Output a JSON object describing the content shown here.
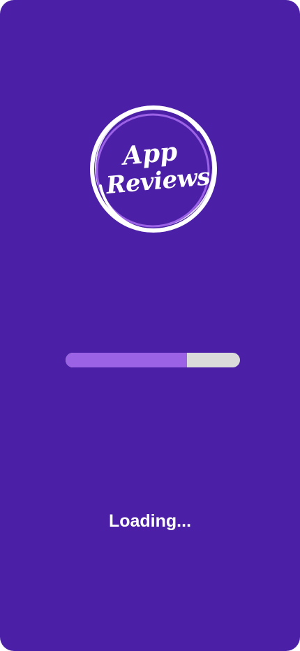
{
  "app": {
    "logo_line1": "App",
    "logo_line2": "Reviews"
  },
  "loading": {
    "label": "Loading...",
    "progress_fraction": 0.695
  },
  "colors": {
    "background": "#4B20A7",
    "progress_fill": "#9B62E6",
    "progress_track": "#DADADA",
    "text": "#FFFFFF"
  }
}
